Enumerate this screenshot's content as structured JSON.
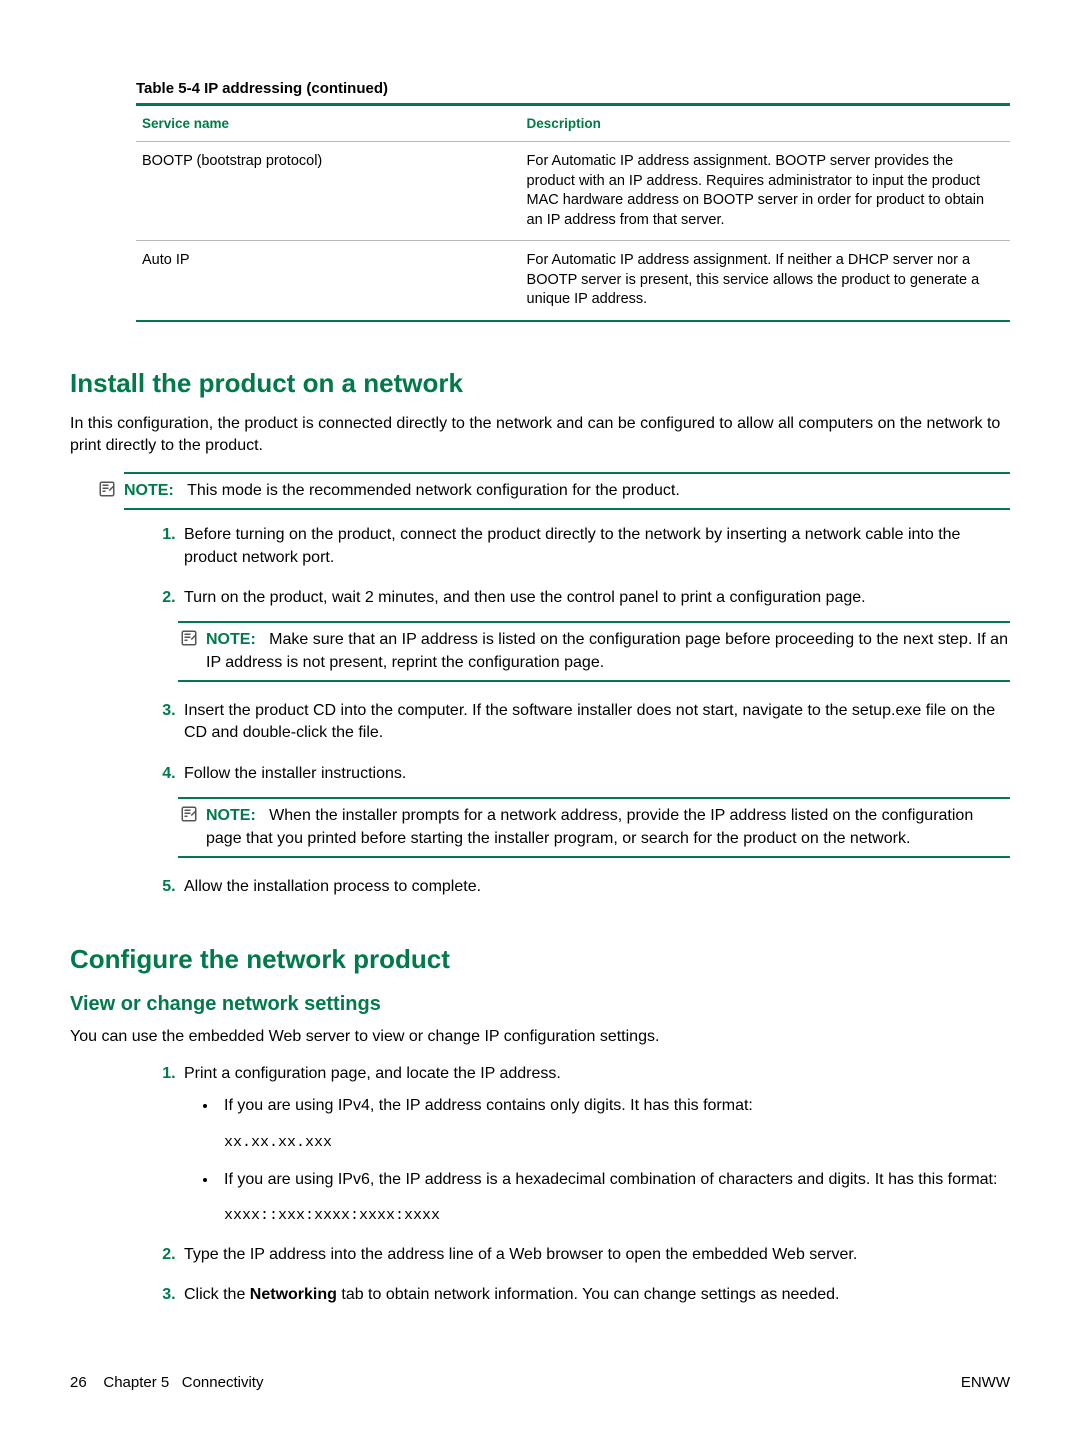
{
  "table": {
    "caption_prefix": "Table 5-4",
    "caption_title": "IP addressing (continued)",
    "headers": {
      "col1": "Service name",
      "col2": "Description"
    },
    "rows": [
      {
        "name": "BOOTP (bootstrap protocol)",
        "desc": "For Automatic IP address assignment. BOOTP server provides the product with an IP address. Requires administrator to input the product MAC hardware address on BOOTP server in order for product to obtain an IP address from that server."
      },
      {
        "name": "Auto IP",
        "desc": "For Automatic IP address assignment. If neither a DHCP server nor a BOOTP server is present, this service allows the product to generate a unique IP address."
      }
    ]
  },
  "section1": {
    "title": "Install the product on a network",
    "intro": "In this configuration, the product is connected directly to the network and can be configured to allow all computers on the network to print directly to the product.",
    "note_label": "NOTE:",
    "note1": "This mode is the recommended network configuration for the product.",
    "steps": {
      "s1": "Before turning on the product, connect the product directly to the network by inserting a network cable into the product network port.",
      "s2": "Turn on the product, wait 2 minutes, and then use the control panel to print a configuration page.",
      "s2_note": "Make sure that an IP address is listed on the configuration page before proceeding to the next step. If an IP address is not present, reprint the configuration page.",
      "s3": "Insert the product CD into the computer. If the software installer does not start, navigate to the setup.exe file on the CD and double-click the file.",
      "s4": "Follow the installer instructions.",
      "s4_note": "When the installer prompts for a network address, provide the IP address listed on the configuration page that you printed before starting the installer program, or search for the product on the network.",
      "s5": "Allow the installation process to complete."
    }
  },
  "section2": {
    "title": "Configure the network product",
    "sub_title": "View or change network settings",
    "intro": "You can use the embedded Web server to view or change IP configuration settings.",
    "steps": {
      "s1": "Print a configuration page, and locate the IP address.",
      "s1_b1": "If you are using IPv4, the IP address contains only digits. It has this format:",
      "s1_b1_code": "xx.xx.xx.xxx",
      "s1_b2": "If you are using IPv6, the IP address is a hexadecimal combination of characters and digits. It has this format:",
      "s1_b2_code": "xxxx::xxx:xxxx:xxxx:xxxx",
      "s2": "Type the IP address into the address line of a Web browser to open the embedded Web server.",
      "s3_pre": "Click the ",
      "s3_bold": "Networking",
      "s3_post": " tab to obtain network information. You can change settings as needed."
    }
  },
  "footer": {
    "page_num": "26",
    "chapter": "Chapter 5",
    "chapter_title": "Connectivity",
    "right": "ENWW"
  }
}
